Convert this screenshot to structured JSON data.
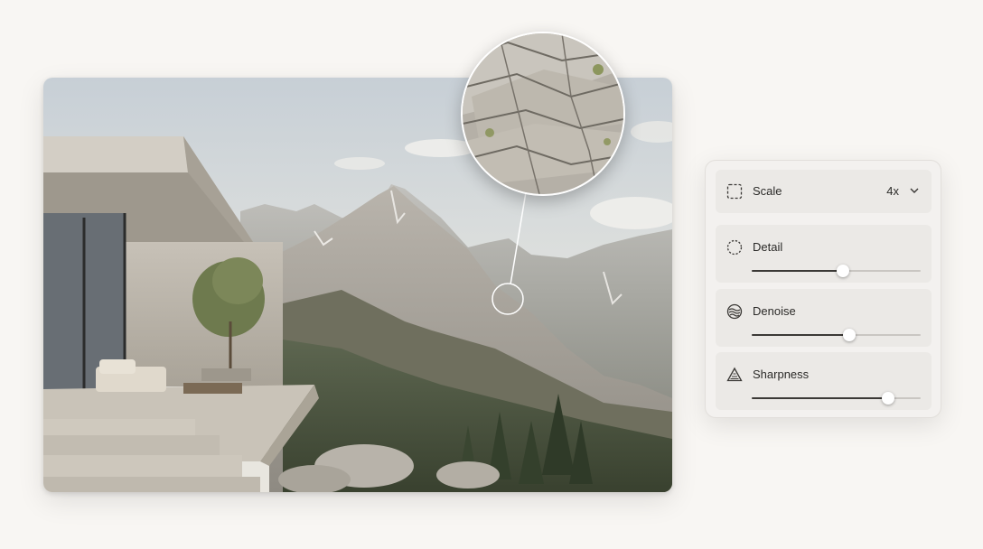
{
  "photo": {
    "alt_icon": "mountain-villa-photo"
  },
  "magnifier": {
    "icon": "rock-texture-zoom"
  },
  "panel": {
    "scale": {
      "label": "Scale",
      "value": "4x",
      "icon": "scale-icon",
      "dropdown_icon": "chevron-down-icon"
    },
    "detail": {
      "label": "Detail",
      "value": 0.54,
      "icon": "detail-icon"
    },
    "denoise": {
      "label": "Denoise",
      "value": 0.58,
      "icon": "denoise-icon"
    },
    "sharpness": {
      "label": "Sharpness",
      "value": 0.81,
      "icon": "sharpness-icon"
    }
  },
  "colors": {
    "background": "#f8f6f3",
    "panel": "#f3f1ef",
    "row": "#ebe9e6",
    "slider_fill": "#3b3936",
    "slider_track": "#c9c6c2"
  }
}
